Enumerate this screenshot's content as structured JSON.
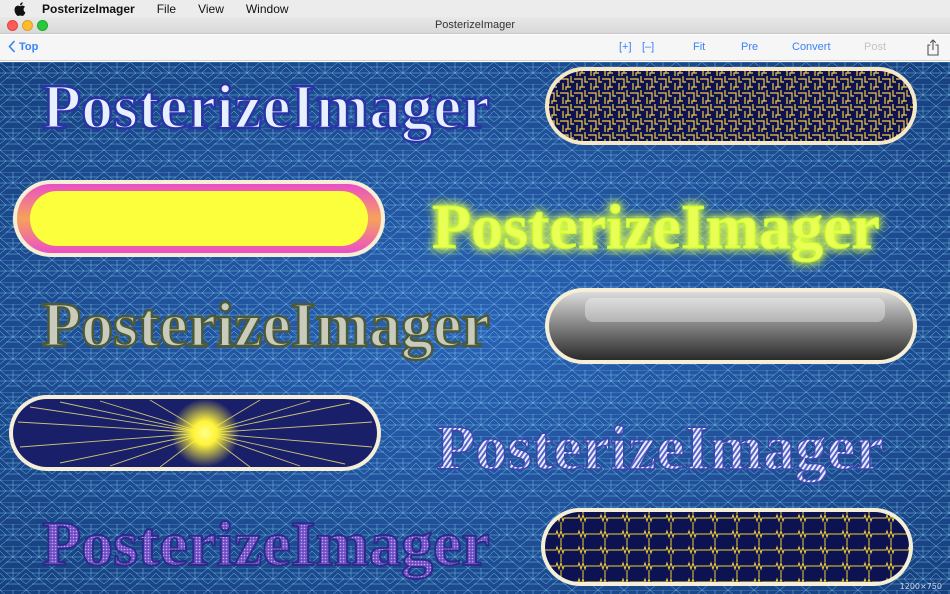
{
  "menubar": {
    "app_name": "PosterizeImager",
    "menus": [
      "File",
      "View",
      "Window"
    ]
  },
  "window": {
    "title": "PosterizeImager"
  },
  "toolbar": {
    "back_label": "Top",
    "zoom_in": "[+]",
    "zoom_out": "[–]",
    "fit": "Fit",
    "pre": "Pre",
    "convert": "Convert",
    "post": "Post",
    "accent_color": "#3a82f7",
    "disabled_color": "#c4c4c4"
  },
  "canvas": {
    "background_color": "#1f4f9a",
    "mesh_color": "#8ee0ff",
    "wordmark": "PosterizeImager",
    "size_label": "1200×750",
    "styles": {
      "outline_text": "#3340a8",
      "glow_text": "#e9ff56",
      "metal_text": "#8c9a7a",
      "stripe_text": "#6a74c8",
      "gradient_text": "#8b5fc8",
      "maze_pill": "#0d1250",
      "yellow_pill": "#fbff3c",
      "pink_rim": "#ea4fc8",
      "gray_pill": "#9a9a9a",
      "sunburst_pill": "#1a1f6a",
      "circuit_pill": "#0d1250"
    }
  }
}
